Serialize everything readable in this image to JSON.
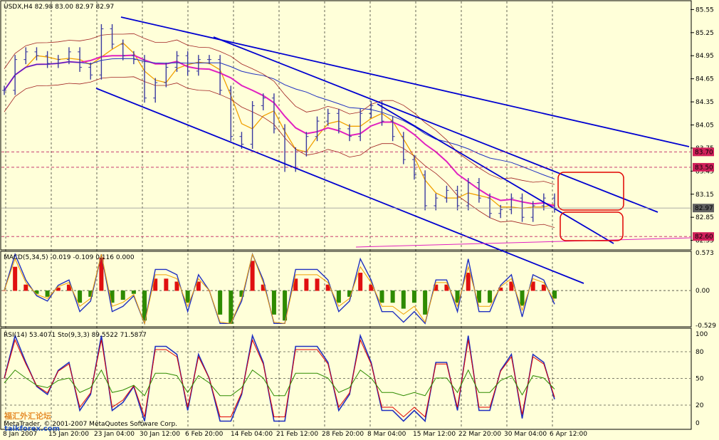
{
  "window": {
    "symbol_info": "USDX,H4  82.98 83.00 82.97 82.97",
    "macd_info": "MACD(5,34,5) -0.019 -0.109 0.116 0.000",
    "rsi_info": "RSI(14) 53.4071  Sto(9,3,3) 89.5522 71.5877",
    "copyright": "MetaTrader, © 2001-2007 MetaQuotes Software Corp.",
    "watermark": "taikforex.com",
    "watermark_cn": "福汇外汇论坛"
  },
  "colors": {
    "background": "#ffffd9",
    "candle": "#3a3aa0",
    "ma_magenta": "#e020c0",
    "ma_orange": "#f0a000",
    "ma_blue": "#2030c0",
    "envelope": "#a02020",
    "trendline": "#0000d0",
    "box": "#e00000",
    "hist_green": "#2e8b00",
    "hist_red": "#e01010"
  },
  "chart_data": [
    {
      "type": "line",
      "title": "USDX,H4",
      "xlabel": "",
      "ylabel": "",
      "ylim": [
        82.5,
        85.6
      ],
      "y_ticks": [
        "85.55",
        "85.25",
        "84.95",
        "84.65",
        "84.35",
        "84.05",
        "83.75",
        "83.45",
        "83.15",
        "82.85",
        "82.55"
      ],
      "x_ticks": [
        "8 Jan 2007",
        "15 Jan 20:00",
        "23 Jan 04:00",
        "30 Jan 12:00",
        "6 Feb 20:00",
        "14 Feb 04:00",
        "21 Feb 12:00",
        "28 Feb 20:00",
        "8 Mar 04:00",
        "15 Mar 12:00",
        "22 Mar 20:00",
        "30 Mar 04:00",
        "6 Apr 12:00"
      ],
      "price_tags": [
        "83.70",
        "83.50",
        "82.97",
        "82.60"
      ],
      "series": [
        {
          "values": [
            84.5,
            84.9,
            85.0,
            84.95,
            84.85,
            84.9,
            85.0,
            84.8,
            84.7,
            85.3,
            85.1,
            84.95,
            84.9,
            84.4,
            84.6,
            84.8,
            84.95,
            84.75,
            84.9,
            84.9,
            84.5,
            83.9,
            83.8,
            84.3,
            84.4,
            84.0,
            83.5,
            83.7,
            83.9,
            84.1,
            84.2,
            84.0,
            83.9,
            84.2,
            84.3,
            84.1,
            83.9,
            83.6,
            83.4,
            83.0,
            83.1,
            83.2,
            83.0,
            83.3,
            83.1,
            82.9,
            82.95,
            83.1,
            82.85,
            83.0,
            83.1,
            82.97
          ]
        }
      ]
    },
    {
      "type": "bar",
      "title": "MACD(5,34,5)",
      "ylim": [
        -0.529,
        0.573
      ],
      "y_ticks": [
        "0.573",
        "0.00",
        "-0.529"
      ]
    },
    {
      "type": "line",
      "title": "RSI(14) / Sto(9,3,3)",
      "ylim": [
        0,
        100
      ],
      "y_ticks": [
        "100",
        "80",
        "50",
        "20",
        "0"
      ]
    }
  ]
}
